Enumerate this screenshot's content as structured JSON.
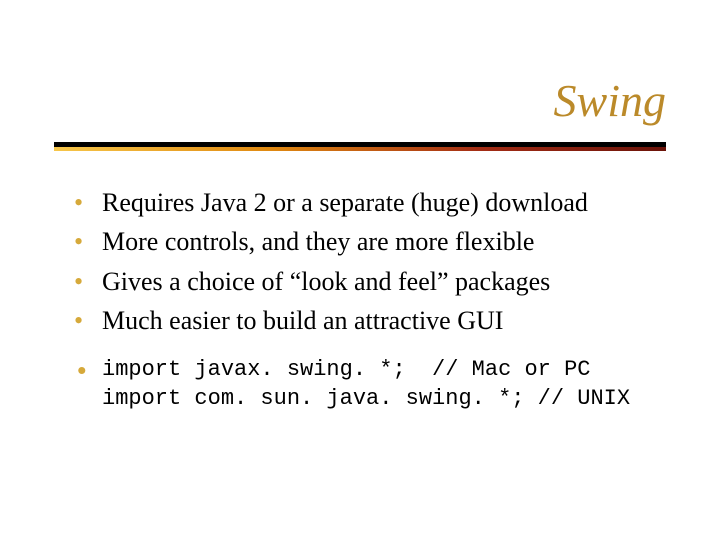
{
  "title": "Swing",
  "bullets": [
    "Requires Java 2 or a separate (huge) download",
    "More controls, and they are more flexible",
    "Gives a choice of “look and feel” packages",
    "Much easier to build an attractive GUI"
  ],
  "code": {
    "line1": "import javax. swing. *;  // Mac or PC",
    "line2": "import com. sun. java. swing. *; // UNIX"
  }
}
